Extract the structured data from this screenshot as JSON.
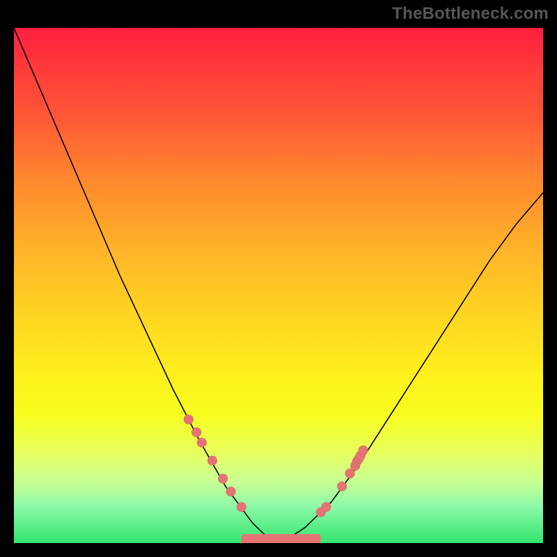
{
  "watermark": "TheBottleneck.com",
  "chart_data": {
    "type": "line",
    "title": "",
    "xlabel": "",
    "ylabel": "",
    "xlim": [
      0,
      100
    ],
    "ylim": [
      0,
      100
    ],
    "grid": false,
    "legend": false,
    "series": [
      {
        "name": "bottleneck-curve",
        "x": [
          0,
          5,
          10,
          15,
          20,
          25,
          30,
          35,
          40,
          45,
          48,
          50,
          52,
          55,
          60,
          65,
          70,
          75,
          80,
          85,
          90,
          95,
          100
        ],
        "y": [
          100,
          88,
          76,
          64,
          52,
          41,
          30,
          20,
          11,
          4,
          1,
          0,
          1,
          3,
          8,
          15,
          23,
          31,
          39,
          47,
          55,
          62,
          68
        ]
      }
    ],
    "markers": {
      "name": "highlight-dots",
      "x": [
        33,
        34.5,
        35.5,
        37.5,
        39.5,
        41,
        43,
        58,
        59,
        62,
        63.5,
        64.5,
        64.8,
        65.2,
        65.5,
        66
      ],
      "y": [
        24,
        21.5,
        19.5,
        16,
        12.5,
        10,
        7,
        6,
        7,
        11,
        13.5,
        15,
        15.8,
        16.4,
        17,
        18
      ]
    },
    "basin": {
      "x_start": 43,
      "x_end": 58,
      "y": 0,
      "thickness": 1.2
    },
    "background": {
      "type": "vertical-gradient",
      "stops": [
        {
          "pos": 0,
          "color": "#ff1f3f"
        },
        {
          "pos": 30,
          "color": "#ff8a2e"
        },
        {
          "pos": 55,
          "color": "#ffd322"
        },
        {
          "pos": 75,
          "color": "#f7fd1f"
        },
        {
          "pos": 100,
          "color": "#33e46e"
        }
      ]
    }
  },
  "colors": {
    "dot": "#e57373",
    "curve": "#000000",
    "frame": "#000000"
  }
}
